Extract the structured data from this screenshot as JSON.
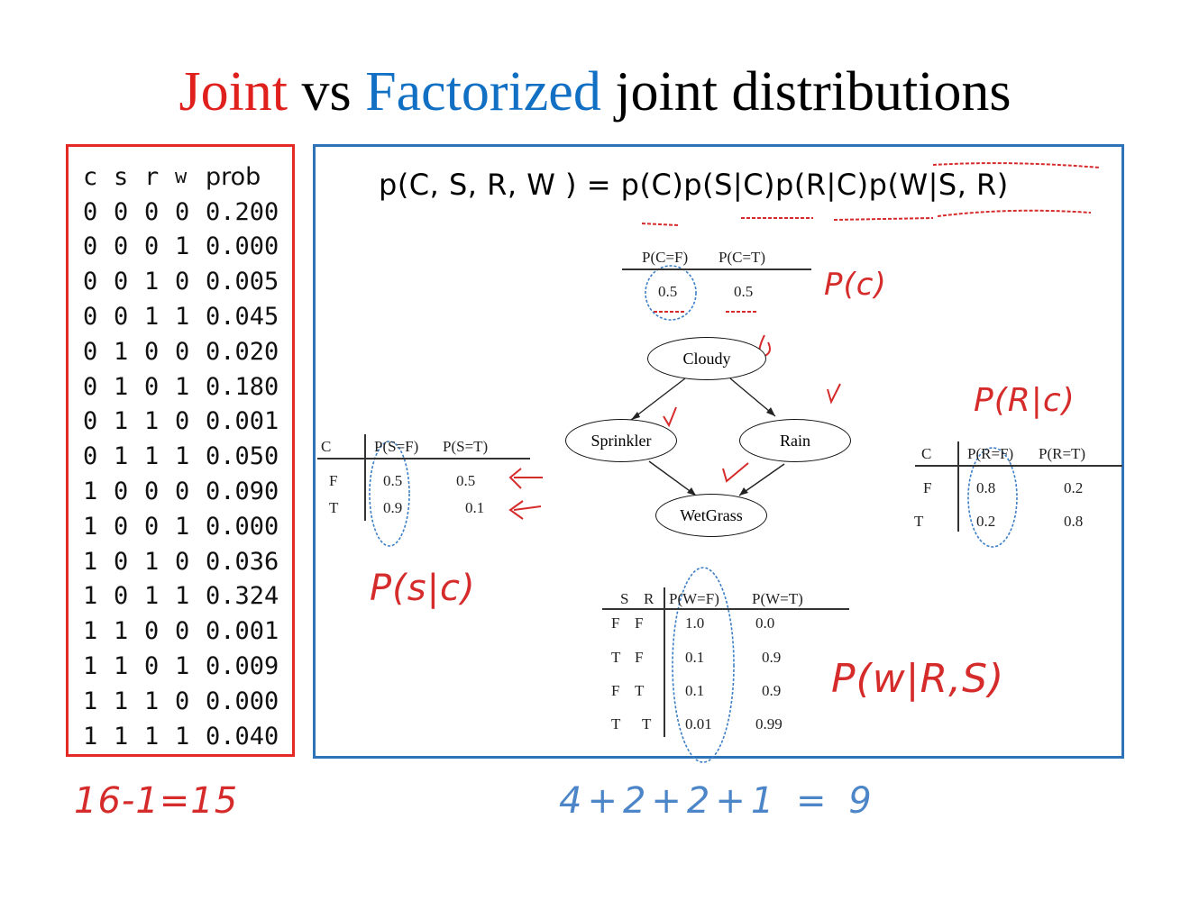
{
  "title": {
    "part1": "Joint",
    "part2": "vs",
    "part3": "Factorized",
    "part4": "joint distributions"
  },
  "joint_table": {
    "headers": [
      "c",
      "s",
      "r",
      "w",
      "prob"
    ],
    "rows": [
      [
        "0",
        "0",
        "0",
        "0",
        "0.200"
      ],
      [
        "0",
        "0",
        "0",
        "1",
        "0.000"
      ],
      [
        "0",
        "0",
        "1",
        "0",
        "0.005"
      ],
      [
        "0",
        "0",
        "1",
        "1",
        "0.045"
      ],
      [
        "0",
        "1",
        "0",
        "0",
        "0.020"
      ],
      [
        "0",
        "1",
        "0",
        "1",
        "0.180"
      ],
      [
        "0",
        "1",
        "1",
        "0",
        "0.001"
      ],
      [
        "0",
        "1",
        "1",
        "1",
        "0.050"
      ],
      [
        "1",
        "0",
        "0",
        "0",
        "0.090"
      ],
      [
        "1",
        "0",
        "0",
        "1",
        "0.000"
      ],
      [
        "1",
        "0",
        "1",
        "0",
        "0.036"
      ],
      [
        "1",
        "0",
        "1",
        "1",
        "0.324"
      ],
      [
        "1",
        "1",
        "0",
        "0",
        "0.001"
      ],
      [
        "1",
        "1",
        "0",
        "1",
        "0.009"
      ],
      [
        "1",
        "1",
        "1",
        "0",
        "0.000"
      ],
      [
        "1",
        "1",
        "1",
        "1",
        "0.040"
      ]
    ]
  },
  "formula": "p(C, S, R, W ) = p(C)p(S|C)p(R|C)p(W|S, R)",
  "network": {
    "nodes": {
      "cloudy": "Cloudy",
      "sprinkler": "Sprinkler",
      "rain": "Rain",
      "wetgrass": "WetGrass"
    }
  },
  "cpt_c": {
    "headers": [
      "P(C=F)",
      "P(C=T)"
    ],
    "values": [
      "0.5",
      "0.5"
    ]
  },
  "cpt_s": {
    "headers": [
      "C",
      "P(S=F)",
      "P(S=T)"
    ],
    "rows": [
      [
        "F",
        "0.5",
        "0.5"
      ],
      [
        "T",
        "0.9",
        "0.1"
      ]
    ]
  },
  "cpt_r": {
    "headers": [
      "C",
      "P(R=F)",
      "P(R=T)"
    ],
    "rows": [
      [
        "F",
        "0.8",
        "0.2"
      ],
      [
        "T",
        "0.2",
        "0.8"
      ]
    ]
  },
  "cpt_w": {
    "headers": [
      "S",
      "R",
      "P(W=F)",
      "P(W=T)"
    ],
    "rows": [
      [
        "F",
        "F",
        "1.0",
        "0.0"
      ],
      [
        "T",
        "F",
        "0.1",
        "0.9"
      ],
      [
        "F",
        "T",
        "0.1",
        "0.9"
      ],
      [
        "T",
        "T",
        "0.01",
        "0.99"
      ]
    ]
  },
  "annotations": {
    "pc": "P(c)",
    "prc": "P(R|c)",
    "psc": "P(s|c)",
    "pwrs": "P(w|R,S)",
    "left_count": "16-1=15",
    "right_count": "4+2+2+1 = 9"
  },
  "colors": {
    "joint_red": "#e0201c",
    "factor_blue": "#1170c4",
    "ink_red": "#d62b2b",
    "ink_blue": "#4d86c8"
  }
}
